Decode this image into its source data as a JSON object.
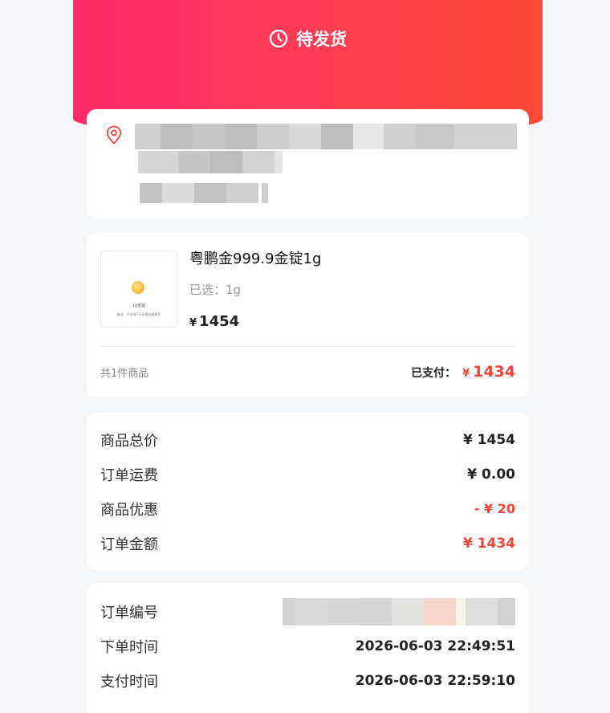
{
  "header": {
    "status": "待发货",
    "status_icon": "clock-icon"
  },
  "address": {
    "icon": "location-pin-icon",
    "accent": "#f2443a"
  },
  "product": {
    "title": "粤鹏金999.9金锭1g",
    "spec_label": "已选：",
    "spec_value": "1g",
    "currency": "¥",
    "price": "1454",
    "thumb_caption": "1g金锭",
    "thumb_note": "备注：不支持7天无理由退换货"
  },
  "order_footer": {
    "count_text": "共1件商品",
    "paid_label": "已支付：",
    "paid_currency": "¥",
    "paid_amount": "1434"
  },
  "summary": {
    "rows": [
      {
        "label": "商品总价",
        "value": "¥ 1454"
      },
      {
        "label": "订单运费",
        "value": "¥ 0.00"
      },
      {
        "label": "商品优惠",
        "value": "- ¥ 20"
      },
      {
        "label": "订单金额",
        "value": "¥ 1434"
      }
    ]
  },
  "order_info": {
    "rows": [
      {
        "label": "订单编号",
        "value": ""
      },
      {
        "label": "下单时间",
        "value": "2026-06-03 22:49:51"
      },
      {
        "label": "支付时间",
        "value": "2026-06-03 22:59:10"
      }
    ]
  },
  "colors": {
    "brand_start": "#ff2a6a",
    "brand_end": "#ff4a34",
    "price_red": "#f2443a"
  }
}
